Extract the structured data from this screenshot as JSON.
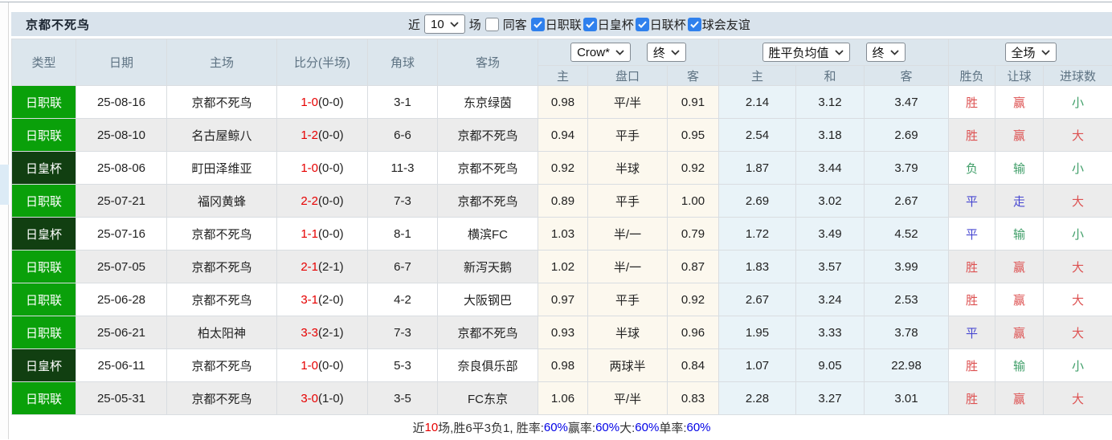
{
  "page_title": "京都不死鸟",
  "colors": {
    "bar_bg": "#d9e3ec",
    "header_bg": "#dce6ed",
    "league_green": "#0aa00a",
    "cup_dark_green": "#113f11",
    "team_highlight_green": "#61a476",
    "score_red": "#e60000",
    "result_red": "#dd5151",
    "result_green": "#3f9e68",
    "result_blue": "#4747d1",
    "checkbox_blue": "#2f80ed",
    "summary_blue": "#0000e6",
    "odds_col_bg": "#fcf8ee",
    "avg_col_bg": "#e9f3f8"
  },
  "filter_bar": {
    "near_label": "近",
    "count_value": "10",
    "count_suffix": "场",
    "same_away_label": "同客",
    "same_away_checked": false,
    "leagues": [
      {
        "label": "日职联",
        "checked": true
      },
      {
        "label": "日皇杯",
        "checked": true
      },
      {
        "label": "日联杯",
        "checked": true
      },
      {
        "label": "球会友谊",
        "checked": true
      }
    ]
  },
  "table": {
    "left_headers": [
      "类型",
      "日期",
      "主场",
      "比分(半场)",
      "角球",
      "客场"
    ],
    "group_selects": {
      "odds_company": "Crow*",
      "odds_time_1": "终",
      "avg_source": "胜平负均值",
      "odds_time_2": "终",
      "scope": "全场"
    },
    "sub_headers": [
      "主",
      "盘口",
      "客",
      "主",
      "和",
      "客",
      "胜负",
      "让球",
      "进球数"
    ],
    "rows": [
      {
        "type": "日职联",
        "cup": false,
        "date": "25-08-16",
        "home": "京都不死鸟",
        "home_hl": true,
        "score": "1-0",
        "half": "(0-0)",
        "corner": "3-1",
        "away": "东京绿茵",
        "away_hl": false,
        "crow": [
          "0.98",
          "平/半",
          "0.91"
        ],
        "avg": [
          "2.14",
          "3.12",
          "3.47"
        ],
        "results": [
          [
            "胜",
            "red"
          ],
          [
            "赢",
            "red"
          ],
          [
            "小",
            "green"
          ]
        ]
      },
      {
        "type": "日职联",
        "cup": false,
        "date": "25-08-10",
        "home": "名古屋鲸八",
        "home_hl": false,
        "score": "1-2",
        "half": "(0-0)",
        "corner": "6-6",
        "away": "京都不死鸟",
        "away_hl": true,
        "crow": [
          "0.94",
          "平手",
          "0.95"
        ],
        "avg": [
          "2.54",
          "3.18",
          "2.69"
        ],
        "results": [
          [
            "胜",
            "red"
          ],
          [
            "赢",
            "red"
          ],
          [
            "大",
            "red"
          ]
        ]
      },
      {
        "type": "日皇杯",
        "cup": true,
        "date": "25-08-06",
        "home": "町田泽维亚",
        "home_hl": false,
        "score": "1-0",
        "half": "(0-0)",
        "corner": "11-3",
        "away": "京都不死鸟",
        "away_hl": true,
        "crow": [
          "0.92",
          "半球",
          "0.92"
        ],
        "avg": [
          "1.87",
          "3.44",
          "3.79"
        ],
        "results": [
          [
            "负",
            "green"
          ],
          [
            "输",
            "green"
          ],
          [
            "小",
            "green"
          ]
        ]
      },
      {
        "type": "日职联",
        "cup": false,
        "date": "25-07-21",
        "home": "福冈黄蜂",
        "home_hl": false,
        "score": "2-2",
        "half": "(0-0)",
        "corner": "7-3",
        "away": "京都不死鸟",
        "away_hl": true,
        "crow": [
          "0.89",
          "平手",
          "1.00"
        ],
        "avg": [
          "2.69",
          "3.02",
          "2.67"
        ],
        "results": [
          [
            "平",
            "blue"
          ],
          [
            "走",
            "blue"
          ],
          [
            "大",
            "red"
          ]
        ]
      },
      {
        "type": "日皇杯",
        "cup": true,
        "date": "25-07-16",
        "home": "京都不死鸟",
        "home_hl": true,
        "score": "1-1",
        "half": "(0-0)",
        "corner": "8-1",
        "away": "横滨FC",
        "away_hl": false,
        "crow": [
          "1.03",
          "半/一",
          "0.79"
        ],
        "avg": [
          "1.72",
          "3.49",
          "4.52"
        ],
        "results": [
          [
            "平",
            "blue"
          ],
          [
            "输",
            "green"
          ],
          [
            "小",
            "green"
          ]
        ]
      },
      {
        "type": "日职联",
        "cup": false,
        "date": "25-07-05",
        "home": "京都不死鸟",
        "home_hl": true,
        "score": "2-1",
        "half": "(2-1)",
        "corner": "6-7",
        "away": "新泻天鹅",
        "away_hl": false,
        "crow": [
          "1.02",
          "半/一",
          "0.87"
        ],
        "avg": [
          "1.83",
          "3.57",
          "3.99"
        ],
        "results": [
          [
            "胜",
            "red"
          ],
          [
            "赢",
            "red"
          ],
          [
            "大",
            "red"
          ]
        ]
      },
      {
        "type": "日职联",
        "cup": false,
        "date": "25-06-28",
        "home": "京都不死鸟",
        "home_hl": true,
        "score": "3-1",
        "half": "(2-0)",
        "corner": "4-2",
        "away": "大阪钢巴",
        "away_hl": false,
        "crow": [
          "0.97",
          "平手",
          "0.92"
        ],
        "avg": [
          "2.67",
          "3.24",
          "2.53"
        ],
        "results": [
          [
            "胜",
            "red"
          ],
          [
            "赢",
            "red"
          ],
          [
            "大",
            "red"
          ]
        ]
      },
      {
        "type": "日职联",
        "cup": false,
        "date": "25-06-21",
        "home": "柏太阳神",
        "home_hl": false,
        "score": "3-3",
        "half": "(2-1)",
        "corner": "7-3",
        "away": "京都不死鸟",
        "away_hl": true,
        "crow": [
          "0.93",
          "半球",
          "0.96"
        ],
        "avg": [
          "1.95",
          "3.33",
          "3.78"
        ],
        "results": [
          [
            "平",
            "blue"
          ],
          [
            "赢",
            "red"
          ],
          [
            "大",
            "red"
          ]
        ]
      },
      {
        "type": "日皇杯",
        "cup": true,
        "date": "25-06-11",
        "home": "京都不死鸟",
        "home_hl": true,
        "score": "1-0",
        "half": "(0-0)",
        "corner": "5-3",
        "away": "奈良俱乐部",
        "away_hl": false,
        "crow": [
          "0.98",
          "两球半",
          "0.84"
        ],
        "avg": [
          "1.07",
          "9.05",
          "22.98"
        ],
        "results": [
          [
            "胜",
            "red"
          ],
          [
            "输",
            "green"
          ],
          [
            "小",
            "green"
          ]
        ]
      },
      {
        "type": "日职联",
        "cup": false,
        "date": "25-05-31",
        "home": "京都不死鸟",
        "home_hl": true,
        "score": "3-0",
        "half": "(1-0)",
        "corner": "3-5",
        "away": "FC东京",
        "away_hl": false,
        "crow": [
          "1.06",
          "平/半",
          "0.83"
        ],
        "avg": [
          "2.28",
          "3.27",
          "3.01"
        ],
        "results": [
          [
            "胜",
            "red"
          ],
          [
            "赢",
            "red"
          ],
          [
            "大",
            "red"
          ]
        ]
      }
    ]
  },
  "summary_segments": [
    {
      "text": "近",
      "color": "default"
    },
    {
      "text": "10",
      "color": "red"
    },
    {
      "text": "场,胜6平3负1, 胜率:",
      "color": "default"
    },
    {
      "text": "60%",
      "color": "blue"
    },
    {
      "text": " 赢率:",
      "color": "default"
    },
    {
      "text": "60%",
      "color": "blue"
    },
    {
      "text": " 大:",
      "color": "default"
    },
    {
      "text": "60%",
      "color": "blue"
    },
    {
      "text": " 单率:",
      "color": "default"
    },
    {
      "text": "60%",
      "color": "blue"
    }
  ]
}
